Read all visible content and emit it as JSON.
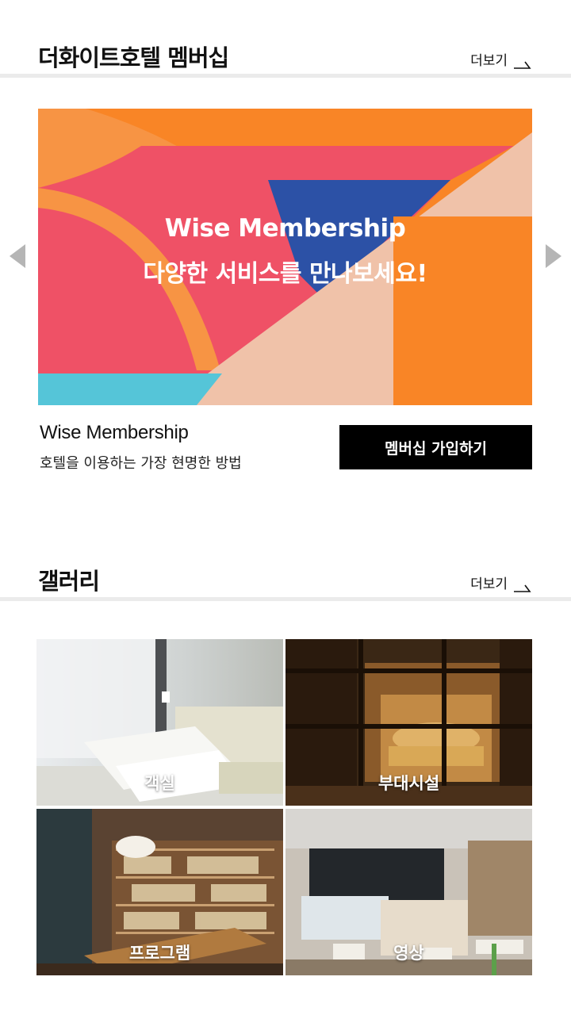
{
  "membership_section": {
    "title": "더화이트호텔 멤버십",
    "more_label": "더보기"
  },
  "banner": {
    "title": "Wise Membership",
    "subtitle": "다양한 서비스를 만나보세요!",
    "colors": {
      "orange": "#f98526",
      "light_orange": "#f79444",
      "red": "#ef5166",
      "blue": "#2c51a6",
      "peach": "#f0c2a9",
      "cyan": "#55c5d8"
    }
  },
  "membership_info": {
    "title": "Wise Membership",
    "description": "호텔을 이용하는 가장 현명한 방법",
    "join_button_label": "멤버십 가입하기"
  },
  "gallery_section": {
    "title": "갤러리",
    "more_label": "더보기",
    "items": [
      {
        "label": "객실",
        "image": "hotel-room-photo"
      },
      {
        "label": "부대시설",
        "image": "lounge-photo"
      },
      {
        "label": "프로그램",
        "image": "library-photo"
      },
      {
        "label": "영상",
        "image": "cafe-photo"
      }
    ]
  },
  "icons": {
    "prev": "triangle-left-icon",
    "next": "triangle-right-icon",
    "more": "corner-arrow-icon"
  }
}
